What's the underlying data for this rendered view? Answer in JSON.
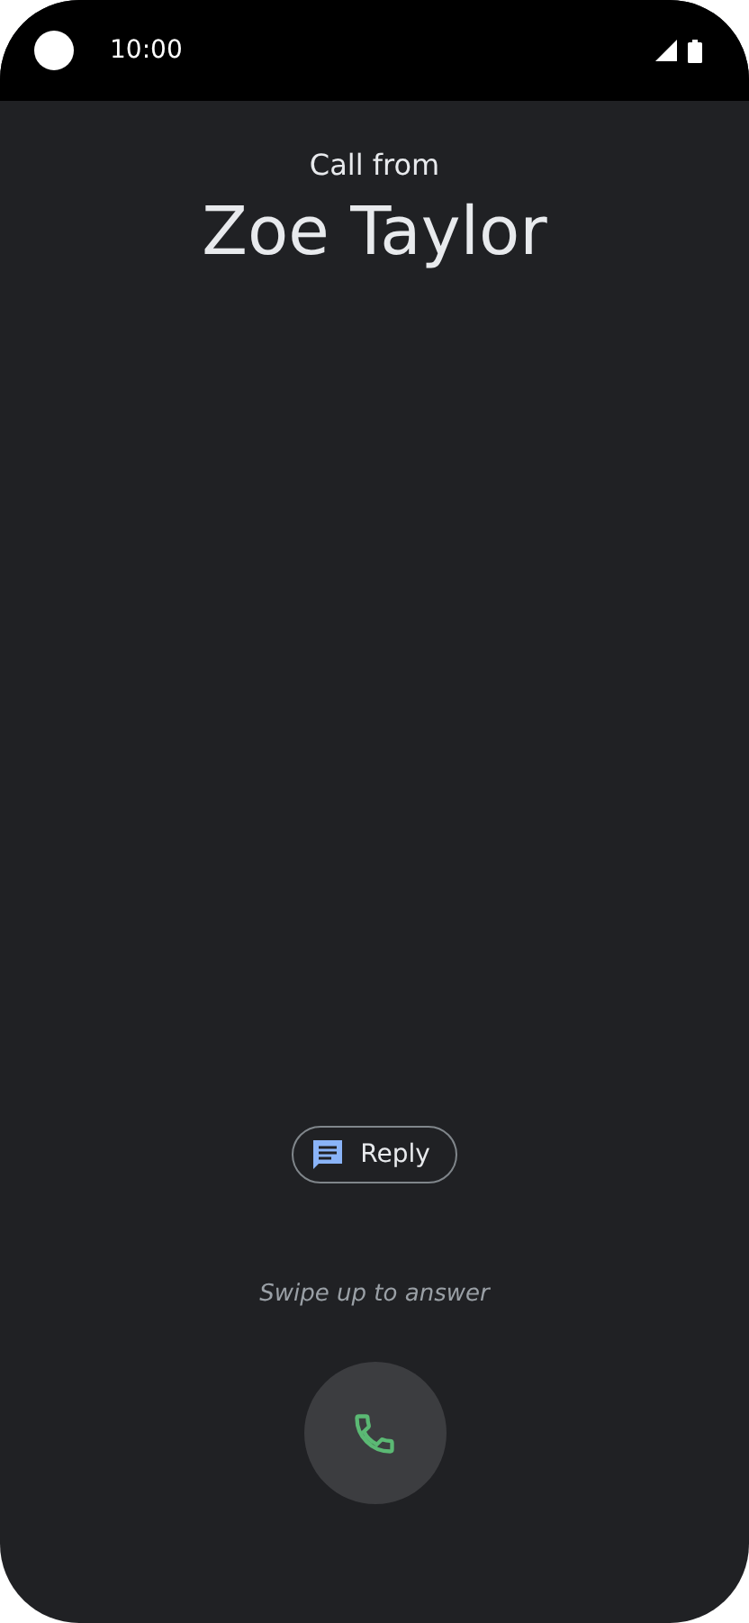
{
  "status_bar": {
    "time": "10:00"
  },
  "caller": {
    "label": "Call from",
    "name": "Zoe Taylor"
  },
  "reply_button": {
    "label": "Reply"
  },
  "hint": "Swipe up to answer"
}
